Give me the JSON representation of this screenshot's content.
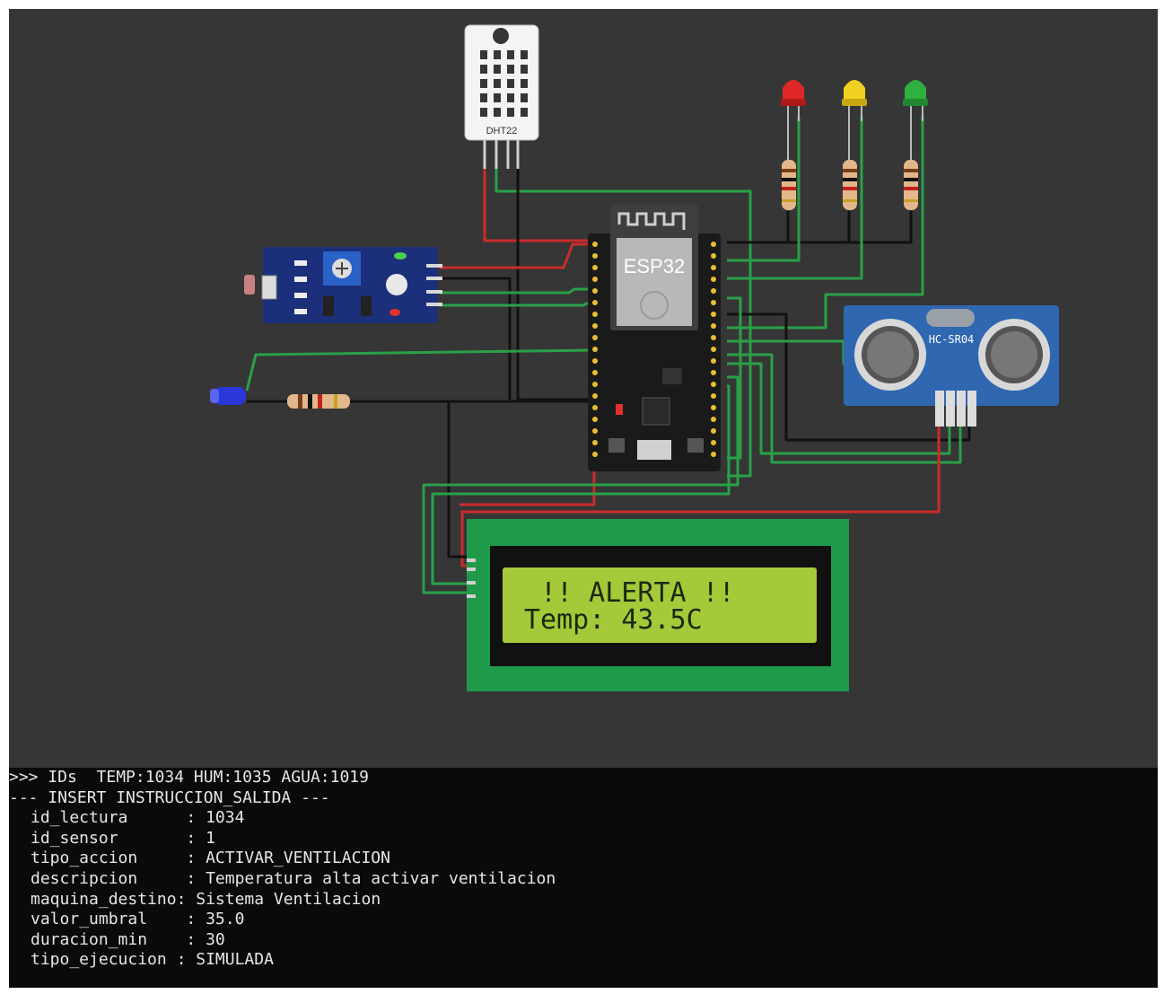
{
  "simulator": {
    "colors": {
      "canvas_bg": "#363636",
      "wire_red": "#cc2b2b",
      "wire_green": "#2aa048",
      "wire_black": "#111111",
      "lcd_screen": "#a6c93a",
      "lcd_board": "#1f9a4a"
    },
    "components": {
      "dht22_label": "DHT22",
      "esp32_label": "ESP32",
      "ultrasonic_label": "HC-SR04",
      "led_colors": [
        "#e02828",
        "#f0d020",
        "#30b040"
      ],
      "lcd_line1": "!! ALERTA !!",
      "lcd_line2": "Temp: 43.5C"
    }
  },
  "console": {
    "line_ids": ">>> IDs  TEMP:1034 HUM:1035 AGUA:1019",
    "line_insert": "--- INSERT INSTRUCCION_SALIDA ---",
    "fields": [
      {
        "key": "id_lectura      ",
        "value": "1034"
      },
      {
        "key": "id_sensor       ",
        "value": "1"
      },
      {
        "key": "tipo_accion     ",
        "value": "ACTIVAR_VENTILACION"
      },
      {
        "key": "descripcion     ",
        "value": "Temperatura alta activar ventilacion"
      },
      {
        "key": "maquina_destino",
        "value": "Sistema Ventilacion"
      },
      {
        "key": "valor_umbral    ",
        "value": "35.0"
      },
      {
        "key": "duracion_min    ",
        "value": "30"
      },
      {
        "key": "tipo_ejecucion ",
        "value": "SIMULADA"
      }
    ]
  }
}
